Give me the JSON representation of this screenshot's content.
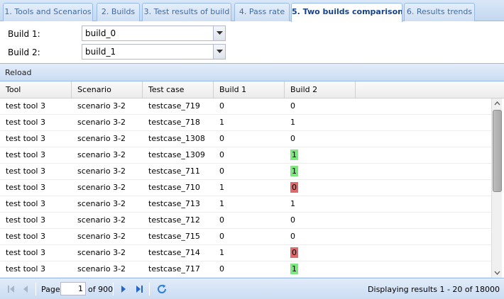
{
  "tabs": [
    {
      "label": "1. Tools and Scenarios",
      "active": false
    },
    {
      "label": "2. Builds",
      "active": false
    },
    {
      "label": "3. Test results of build",
      "active": false
    },
    {
      "label": "4. Pass rate",
      "active": false
    },
    {
      "label": "5. Two builds comparison",
      "active": true
    },
    {
      "label": "6. Results trends",
      "active": false
    }
  ],
  "form": {
    "build1_label": "Build 1:",
    "build1_value": "build_0",
    "build2_label": "Build 2:",
    "build2_value": "build_1"
  },
  "toolbar": {
    "reload_label": "Reload"
  },
  "grid": {
    "columns": [
      "Tool",
      "Scenario",
      "Test case",
      "Build 1",
      "Build 2"
    ],
    "rows": [
      {
        "tool": "test tool 3",
        "scenario": "scenario 3-2",
        "testcase": "testcase_719",
        "build1": "0",
        "build2": "0",
        "change": "none"
      },
      {
        "tool": "test tool 3",
        "scenario": "scenario 3-2",
        "testcase": "testcase_718",
        "build1": "1",
        "build2": "1",
        "change": "none"
      },
      {
        "tool": "test tool 3",
        "scenario": "scenario 3-2",
        "testcase": "testcase_1308",
        "build1": "0",
        "build2": "0",
        "change": "none"
      },
      {
        "tool": "test tool 3",
        "scenario": "scenario 3-2",
        "testcase": "testcase_1309",
        "build1": "0",
        "build2": "1",
        "change": "up"
      },
      {
        "tool": "test tool 3",
        "scenario": "scenario 3-2",
        "testcase": "testcase_711",
        "build1": "0",
        "build2": "1",
        "change": "up"
      },
      {
        "tool": "test tool 3",
        "scenario": "scenario 3-2",
        "testcase": "testcase_710",
        "build1": "1",
        "build2": "0",
        "change": "down"
      },
      {
        "tool": "test tool 3",
        "scenario": "scenario 3-2",
        "testcase": "testcase_713",
        "build1": "1",
        "build2": "1",
        "change": "none"
      },
      {
        "tool": "test tool 3",
        "scenario": "scenario 3-2",
        "testcase": "testcase_712",
        "build1": "0",
        "build2": "0",
        "change": "none"
      },
      {
        "tool": "test tool 3",
        "scenario": "scenario 3-2",
        "testcase": "testcase_715",
        "build1": "0",
        "build2": "0",
        "change": "none"
      },
      {
        "tool": "test tool 3",
        "scenario": "scenario 3-2",
        "testcase": "testcase_714",
        "build1": "1",
        "build2": "0",
        "change": "down"
      },
      {
        "tool": "test tool 3",
        "scenario": "scenario 3-2",
        "testcase": "testcase_717",
        "build1": "0",
        "build2": "1",
        "change": "up"
      }
    ]
  },
  "pager": {
    "page_label": "Page",
    "current_page": "1",
    "of_pages": "of 900",
    "display_info": "Displaying results 1 - 20 of 18000"
  },
  "colors": {
    "improved": "#7de87d",
    "regressed": "#e06a6a",
    "accent": "#15428b"
  },
  "scroll": {
    "position_fraction": 0.0
  }
}
